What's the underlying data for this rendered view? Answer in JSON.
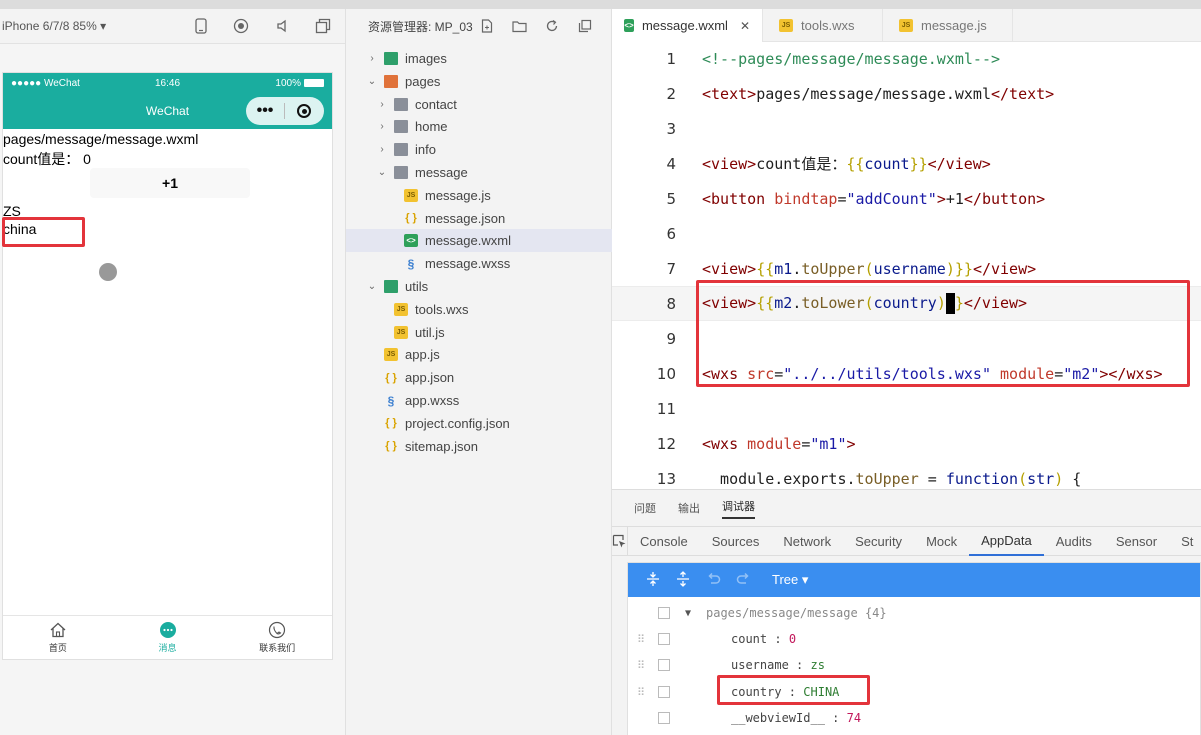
{
  "simulator": {
    "device_label": "iPhone 6/7/8 85% ▾",
    "status": {
      "carrier": "●●●●● WeChat",
      "time": "16:46",
      "battery": "100%"
    },
    "nav_title": "WeChat",
    "capsule_dots": "•••",
    "content": {
      "path": "pages/message/message.wxml",
      "count_line": "count值是： 0",
      "button_label": "+1",
      "username_line": "ZS",
      "country_line": "china"
    },
    "tabbar": [
      {
        "label": "首页",
        "icon": "home-icon"
      },
      {
        "label": "消息",
        "icon": "message-icon"
      },
      {
        "label": "联系我们",
        "icon": "phone-icon"
      }
    ]
  },
  "explorer": {
    "title": "资源管理器: MP_03",
    "tree": [
      {
        "label": "images",
        "kind": "folder-green",
        "indent": 0,
        "chevron": "›"
      },
      {
        "label": "pages",
        "kind": "folder-orange",
        "indent": 0,
        "chevron": "⌄"
      },
      {
        "label": "contact",
        "kind": "folder",
        "indent": 1,
        "chevron": "›"
      },
      {
        "label": "home",
        "kind": "folder",
        "indent": 1,
        "chevron": "›"
      },
      {
        "label": "info",
        "kind": "folder",
        "indent": 1,
        "chevron": "›"
      },
      {
        "label": "message",
        "kind": "folder",
        "indent": 1,
        "chevron": "⌄"
      },
      {
        "label": "message.js",
        "kind": "js",
        "indent": 2,
        "chevron": ""
      },
      {
        "label": "message.json",
        "kind": "json",
        "indent": 2,
        "chevron": ""
      },
      {
        "label": "message.wxml",
        "kind": "wxml",
        "indent": 2,
        "chevron": "",
        "selected": true
      },
      {
        "label": "message.wxss",
        "kind": "wxss",
        "indent": 2,
        "chevron": ""
      },
      {
        "label": "utils",
        "kind": "folder-green",
        "indent": 0,
        "chevron": "⌄"
      },
      {
        "label": "tools.wxs",
        "kind": "js",
        "indent": 1,
        "chevron": ""
      },
      {
        "label": "util.js",
        "kind": "js",
        "indent": 1,
        "chevron": ""
      },
      {
        "label": "app.js",
        "kind": "js",
        "indent": 0,
        "chevron": ""
      },
      {
        "label": "app.json",
        "kind": "json",
        "indent": 0,
        "chevron": ""
      },
      {
        "label": "app.wxss",
        "kind": "wxss",
        "indent": 0,
        "chevron": ""
      },
      {
        "label": "project.config.json",
        "kind": "json",
        "indent": 0,
        "chevron": ""
      },
      {
        "label": "sitemap.json",
        "kind": "json",
        "indent": 0,
        "chevron": ""
      }
    ]
  },
  "editor": {
    "tabs": [
      {
        "label": "message.wxml",
        "icon": "wxml-file-icon",
        "active": true,
        "close": "✕"
      },
      {
        "label": "tools.wxs",
        "icon": "js-file-icon",
        "active": false
      },
      {
        "label": "message.js",
        "icon": "js-file-icon",
        "active": false
      }
    ],
    "line_numbers": [
      "1",
      "2",
      "3",
      "4",
      "5",
      "6",
      "7",
      "8",
      "9",
      "10",
      "11",
      "12",
      "13"
    ]
  },
  "debugger": {
    "panel_tabs": [
      "问题",
      "输出",
      "调试器"
    ],
    "dev_tabs": [
      "Console",
      "Sources",
      "Network",
      "Security",
      "Mock",
      "AppData",
      "Audits",
      "Sensor",
      "St"
    ],
    "view_mode": "Tree ▾",
    "root": "pages/message/message {4}",
    "rows": [
      {
        "key": "count",
        "value": "0"
      },
      {
        "key": "username",
        "value": "zs"
      },
      {
        "key": "country",
        "value": "CHINA"
      },
      {
        "key": "__webviewId__",
        "value": "74"
      }
    ]
  },
  "colors": {
    "wechat_green": "#1aad9f",
    "highlight_red": "#e3343b",
    "appdata_blue": "#3a8ef0"
  }
}
